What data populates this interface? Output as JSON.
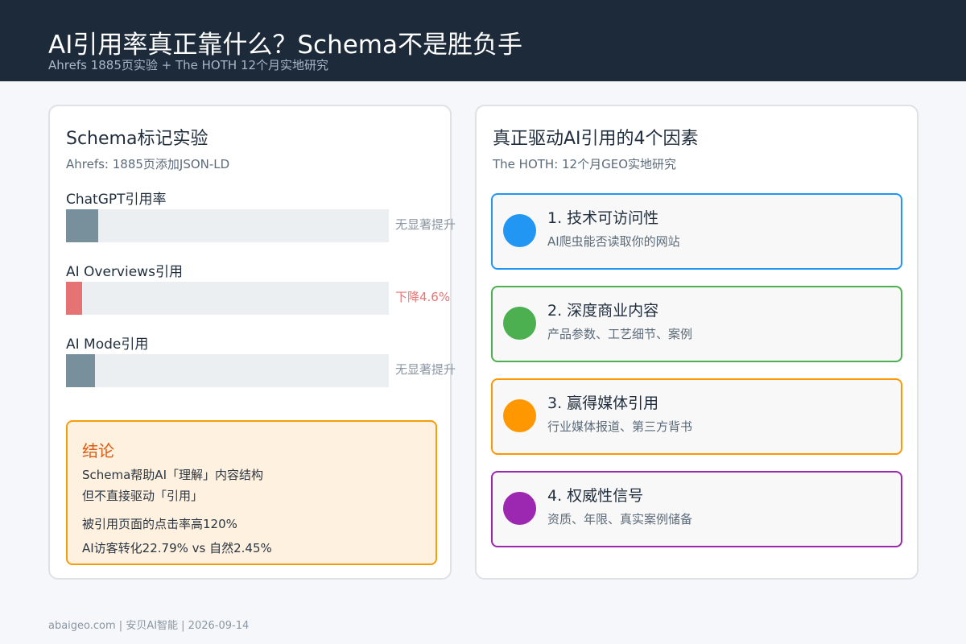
{
  "header": {
    "title": "AI引用率真正靠什么？Schema不是胜负手",
    "subtitle": "Ahrefs 1885页实验 + The HOTH 12个月实地研究"
  },
  "left_card": {
    "title": "Schema标记实验",
    "subtitle": "Ahrefs: 1885页添加JSON-LD",
    "metrics": [
      {
        "label": "ChatGPT引用率",
        "note": "无显著提升",
        "fill_fraction": 0.1,
        "color": "#78909c",
        "note_color": "#8a96a3"
      },
      {
        "label": "AI Overviews引用",
        "note": "下降4.6%",
        "fill_fraction": 0.05,
        "color": "#e57373",
        "note_color": "#e57373"
      },
      {
        "label": "AI Mode引用",
        "note": "无显著提升",
        "fill_fraction": 0.09,
        "color": "#78909c",
        "note_color": "#8a96a3"
      }
    ],
    "conclusion": {
      "title": "结论",
      "lines": [
        "Schema帮助AI「理解」内容结构",
        "但不直接驱动「引用」",
        "被引用页面的点击率高120%",
        "AI访客转化22.79% vs 自然2.45%"
      ]
    }
  },
  "right_card": {
    "title": "真正驱动AI引用的4个因素",
    "subtitle": "The HOTH: 12个月GEO实地研究",
    "factors": [
      {
        "title": "1. 技术可访问性",
        "desc": "AI爬虫能否读取你的网站",
        "color": "#2196f3"
      },
      {
        "title": "2. 深度商业内容",
        "desc": "产品参数、工艺细节、案例",
        "color": "#4caf50"
      },
      {
        "title": "3. 赢得媒体引用",
        "desc": "行业媒体报道、第三方背书",
        "color": "#ff9800"
      },
      {
        "title": "4. 权威性信号",
        "desc": "资质、年限、真实案例储备",
        "color": "#9c27b0"
      }
    ]
  },
  "footer": {
    "text": "abaigeo.com | 安贝AI智能 | 2026-09-14"
  }
}
